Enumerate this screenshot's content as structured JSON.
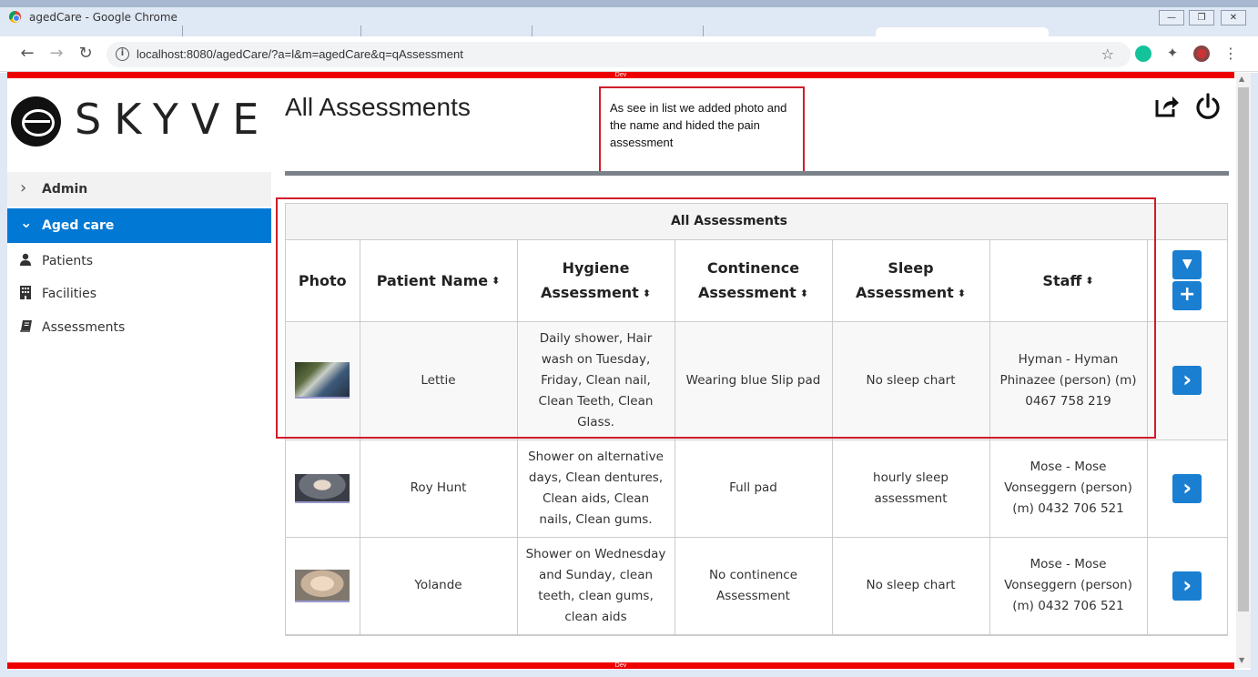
{
  "window": {
    "title": "agedCare - Google Chrome",
    "controls": [
      "—",
      "❐",
      "✕"
    ]
  },
  "browser": {
    "url": "localhost:8080/agedCare/?a=l&m=agedCare&q=qAssessment",
    "back": "←",
    "forward": "→",
    "reload": "↻",
    "info": "i",
    "bookmark": "☆",
    "menu": "⋮"
  },
  "dev_label": "Dev",
  "brand": {
    "logo_text": "SKYVE"
  },
  "sidebar": {
    "groups": [
      {
        "label": "Admin",
        "chevron": "›",
        "expanded": false
      },
      {
        "label": "Aged care",
        "chevron": "⌄",
        "expanded": true
      }
    ],
    "items": [
      {
        "label": "Patients",
        "icon": "user-icon"
      },
      {
        "label": "Facilities",
        "icon": "building-icon"
      },
      {
        "label": "Assessments",
        "icon": "book-icon"
      }
    ]
  },
  "main": {
    "title": "All Assessments",
    "annotation": "As see in list we added photo and the name and hided the pain assessment"
  },
  "grid": {
    "title": "All Assessments",
    "columns": [
      {
        "line1": "Photo",
        "line2": "",
        "sortable": false
      },
      {
        "line1": "Patient Name",
        "line2": "",
        "sortable": true
      },
      {
        "line1": "Hygiene",
        "line2": "Assessment",
        "sortable": true
      },
      {
        "line1": "Continence",
        "line2": "Assessment",
        "sortable": true
      },
      {
        "line1": "Sleep",
        "line2": "Assessment",
        "sortable": true
      },
      {
        "line1": "Staff",
        "line2": "",
        "sortable": true
      }
    ],
    "sort_glyph": "⬍",
    "filter_glyph": "▼",
    "add_glyph": "+",
    "open_glyph": "›",
    "rows": [
      {
        "patient": "Lettie",
        "hygiene": "Daily shower, Hair wash on Tuesday, Friday, Clean nail, Clean Teeth, Clean Glass.",
        "continence": "Wearing blue Slip pad",
        "sleep": "No sleep chart",
        "staff": "Hyman - Hyman Phinazee (person) (m) 0467 758 219"
      },
      {
        "patient": "Roy Hunt",
        "hygiene": "Shower on alternative days, Clean dentures, Clean aids, Clean nails, Clean gums.",
        "continence": "Full pad",
        "sleep": "hourly sleep assessment",
        "staff": "Mose - Mose Vonseggern (person) (m) 0432 706 521"
      },
      {
        "patient": "Yolande",
        "hygiene": "Shower on Wednesday and Sunday, clean teeth, clean gums, clean aids",
        "continence": "No continence Assessment",
        "sleep": "No sleep chart",
        "staff": "Mose - Mose Vonseggern (person) (m) 0432 706 521"
      }
    ]
  },
  "colors": {
    "accent": "#0078d4",
    "button": "#1a7fd1",
    "dev_bar": "#ee0000",
    "annotation_border": "#d01c2a"
  }
}
